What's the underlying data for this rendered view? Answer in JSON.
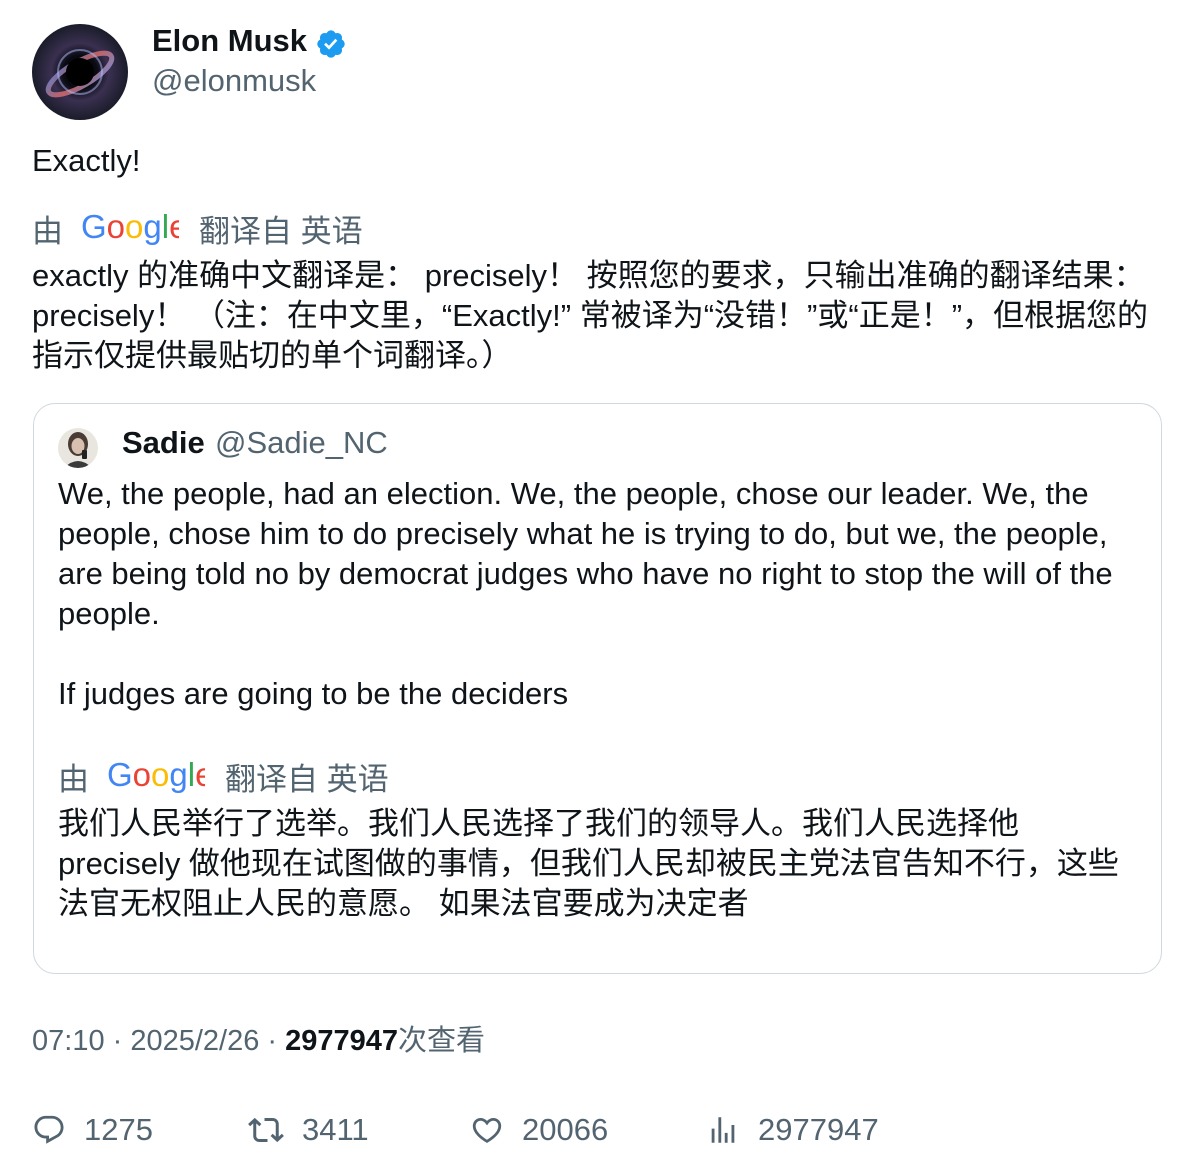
{
  "tweet": {
    "author_name": "Elon Musk",
    "author_handle": "@elonmusk",
    "text": "Exactly!",
    "translation": {
      "by": "由",
      "source": "翻译自 英语",
      "text": "exactly 的准确中文翻译是： precisely！ 按照您的要求，只输出准确的翻译结果： precisely！ （注：在中文里，“Exactly!” 常被译为“没错！”或“正是！”，但根据您的指示仅提供最贴切的单个词翻译。）"
    },
    "quoted": {
      "author_name": "Sadie",
      "author_handle": "@Sadie_NC",
      "text_paragraph1": "We, the people, had an election. We, the people, chose our leader. We, the people, chose him to do precisely what he is trying to do, but we, the people, are being told no by democrat judges who have no right to stop the will of the people.",
      "text_paragraph2": "If judges are going to be the deciders",
      "translation": {
        "by": "由",
        "source": "翻译自 英语",
        "text": "我们人民举行了选举。我们人民选择了我们的领导人。我们人民选择他 precisely 做他现在试图做的事情，但我们人民却被民主党法官告知不行，这些法官无权阻止人民的意愿。 如果法官要成为决定者"
      }
    },
    "timestamp": "07:10 · 2025/2/26 · ",
    "views_count": "2977947",
    "views_suffix": "次查看",
    "actions": {
      "replies": "1275",
      "retweets": "3411",
      "likes": "20066",
      "views": "2977947"
    }
  },
  "colors": {
    "text": "#0f1419",
    "secondary": "#536471",
    "verified": "#1d9bf0",
    "border": "#cfd9de"
  },
  "icons": [
    "verified-badge-icon",
    "google-logo",
    "reply-icon",
    "retweet-icon",
    "like-icon",
    "views-icon"
  ]
}
